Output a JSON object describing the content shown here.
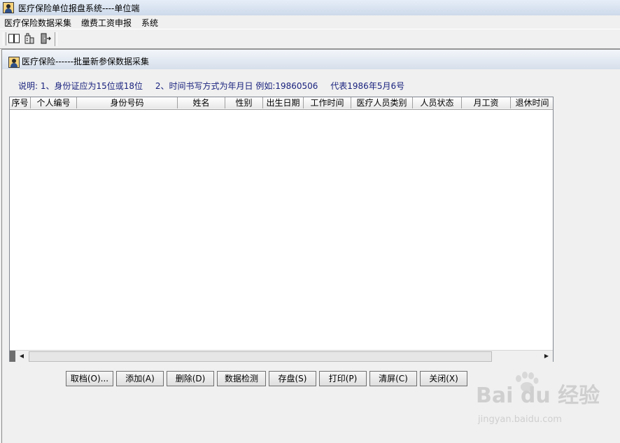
{
  "window": {
    "title": "医疗保险单位报盘系统----单位端"
  },
  "menubar": {
    "items": [
      "医疗保险数据采集",
      "缴费工资申报",
      "系统"
    ]
  },
  "toolbar": {
    "icons": [
      "book-icon",
      "building-icon",
      "exit-door-icon"
    ]
  },
  "child_window": {
    "title": "医疗保险------批量新参保数据采集"
  },
  "note": {
    "part1": "说明: 1、身份证应为15位或18位",
    "part2": "2、时间书写方式为年月日  例如:19860506",
    "part3": "代表1986年5月6号"
  },
  "grid": {
    "columns": [
      "序号",
      "个人编号",
      "身份号码",
      "姓名",
      "性别",
      "出生日期",
      "工作时间",
      "医疗人员类别",
      "人员状态",
      "月工资",
      "退休时间"
    ],
    "rows": []
  },
  "buttons": {
    "cancel": "取档(O)...",
    "add": "添加(A)",
    "delete": "删除(D)",
    "check": "数据检测",
    "save": "存盘(S)",
    "print": "打印(P)",
    "clear": "清屏(C)",
    "close": "关闭(X)"
  },
  "watermark": {
    "brand": "Bai du 经验",
    "url": "jingyan.baidu.com"
  }
}
